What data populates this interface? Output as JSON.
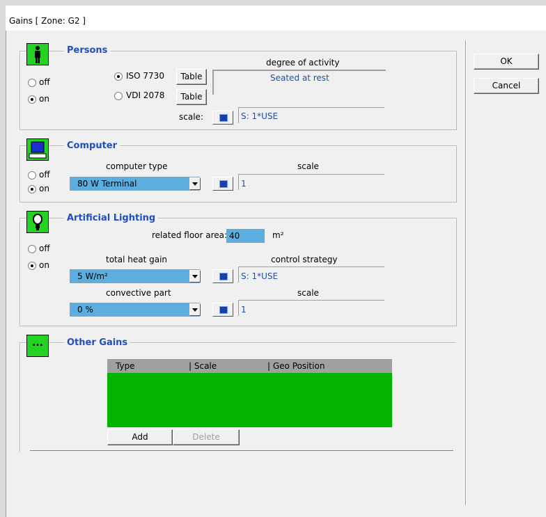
{
  "window": {
    "title": "Gains [ Zone: G2 ]"
  },
  "buttons": {
    "ok": "OK",
    "cancel": "Cancel"
  },
  "persons": {
    "title": "Persons",
    "off": "off",
    "on": "on",
    "iso": "ISO 7730",
    "vdi": "VDI 2078",
    "table1": "Table",
    "table2": "Table",
    "activity_label": "degree of activity",
    "activity_value": "Seated at rest",
    "scale_label": "scale:",
    "scale_value": "S: 1*USE"
  },
  "computer": {
    "title": "Computer",
    "off": "off",
    "on": "on",
    "type_label": "computer type",
    "type_value": "80 W  Terminal",
    "scale_label": "scale",
    "scale_value": "1"
  },
  "lighting": {
    "title": "Artificial Lighting",
    "off": "off",
    "on": "on",
    "floor_area_label": "related floor area:",
    "floor_area_value": "40",
    "floor_area_unit": "m²",
    "heat_gain_label": "total heat gain",
    "heat_gain_value": "5  W/m²",
    "control_label": "control strategy",
    "control_value": "S: 1*USE",
    "convective_label": "convective part",
    "convective_value": "0  %",
    "scale_label": "scale",
    "scale_value": "1"
  },
  "other": {
    "title": "Other Gains",
    "icon_text": "...",
    "columns": [
      "Type",
      "| Scale",
      "| Geo Position"
    ],
    "add": "Add",
    "delete": "Delete"
  }
}
